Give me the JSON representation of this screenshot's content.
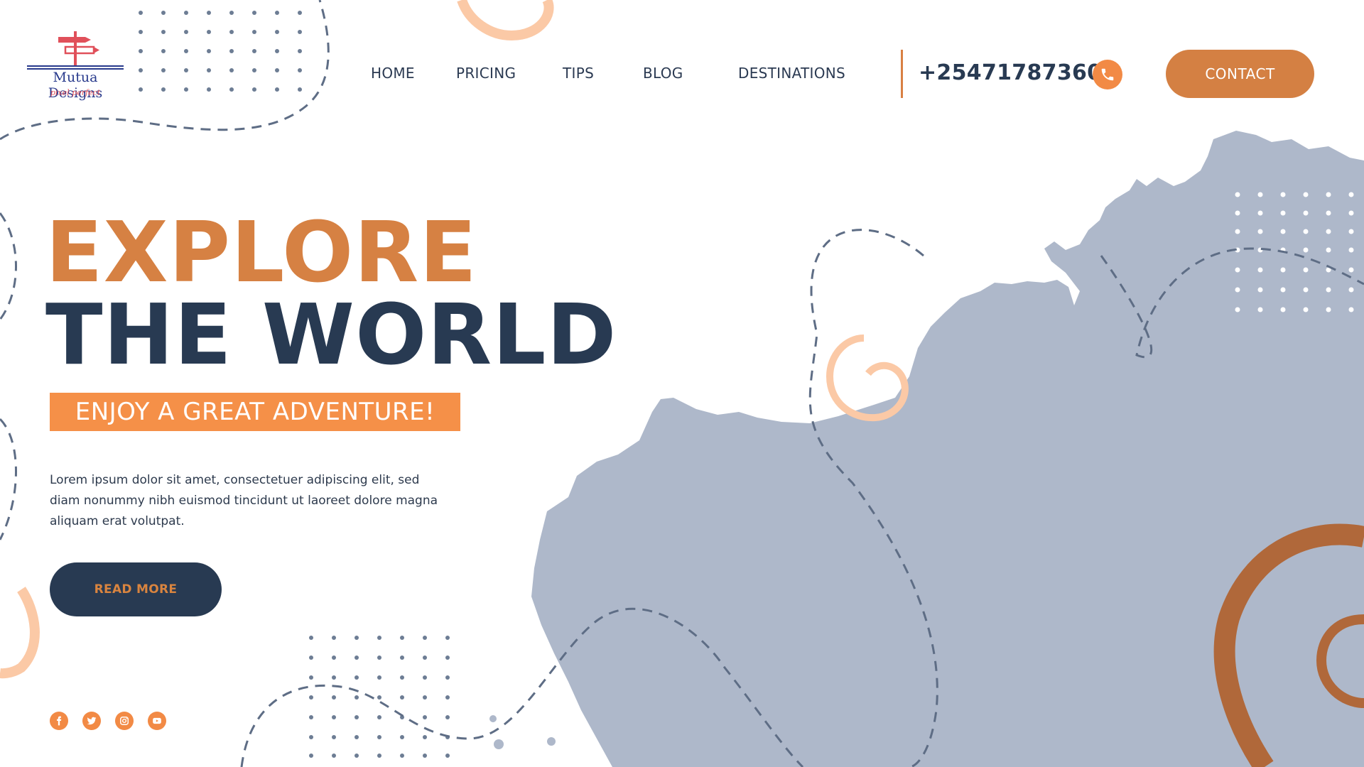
{
  "brand": {
    "name": "Mutua Designs",
    "tagline": "pixel perfect"
  },
  "nav": {
    "items": [
      {
        "label": "HOME"
      },
      {
        "label": "PRICING"
      },
      {
        "label": "TIPS"
      },
      {
        "label": "BLOG"
      },
      {
        "label": "DESTINATIONS"
      }
    ],
    "phone": "+254717873600",
    "contact_label": "CONTACT"
  },
  "hero": {
    "line1": "EXPLORE",
    "line2": "THE WORLD",
    "tagline": "ENJOY A GREAT ADVENTURE!",
    "body": "Lorem ipsum dolor sit amet, consectetuer adipiscing elit, sed diam nonummy nibh euismod tincidunt ut laoreet dolore magna aliquam erat volutpat.",
    "cta_label": "READ MORE"
  },
  "socials": [
    {
      "icon": "facebook-icon"
    },
    {
      "icon": "twitter-icon"
    },
    {
      "icon": "instagram-icon"
    },
    {
      "icon": "youtube-icon"
    }
  ],
  "colors": {
    "accent_orange": "#d68143",
    "bright_orange": "#f59048",
    "navy": "#283a52",
    "map_blue": "#aeb8ca",
    "swirl_brown": "#b0683a",
    "peach": "#fbc9a6"
  }
}
